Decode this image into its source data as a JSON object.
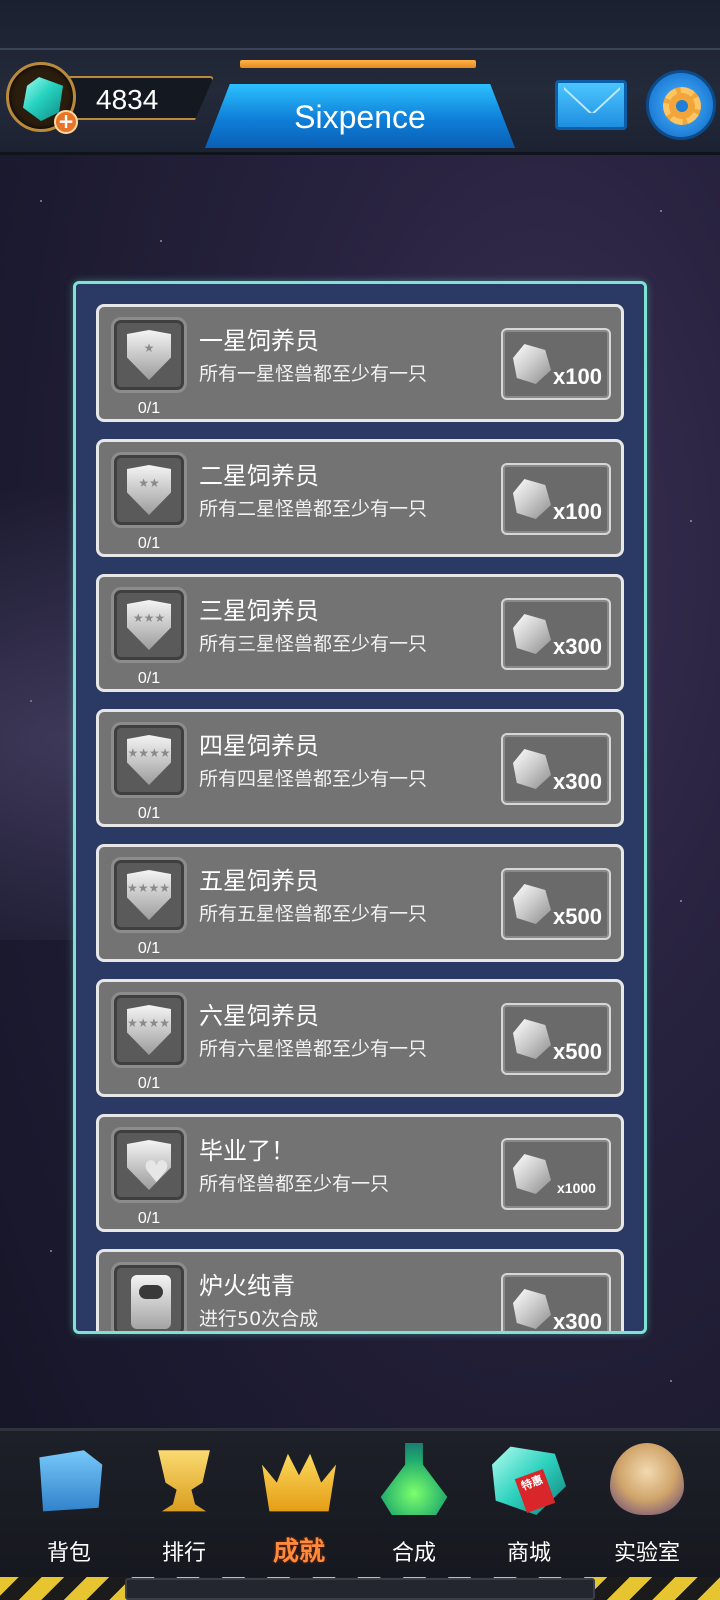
{
  "header": {
    "currency_amount": "4834",
    "player_name": "Sixpence"
  },
  "achievements": [
    {
      "title": "一星饲养员",
      "desc": "所有一星怪兽都至少有一只",
      "progress": "0/1",
      "reward": "x100",
      "badge": "shield-1-star-icon",
      "stars": "★"
    },
    {
      "title": "二星饲养员",
      "desc": "所有二星怪兽都至少有一只",
      "progress": "0/1",
      "reward": "x100",
      "badge": "shield-2-star-icon",
      "stars": "★★"
    },
    {
      "title": "三星饲养员",
      "desc": "所有三星怪兽都至少有一只",
      "progress": "0/1",
      "reward": "x300",
      "badge": "shield-3-star-icon",
      "stars": "★★★"
    },
    {
      "title": "四星饲养员",
      "desc": "所有四星怪兽都至少有一只",
      "progress": "0/1",
      "reward": "x300",
      "badge": "shield-4-star-icon",
      "stars": "★★★★"
    },
    {
      "title": "五星饲养员",
      "desc": "所有五星怪兽都至少有一只",
      "progress": "0/1",
      "reward": "x500",
      "badge": "shield-5-star-icon",
      "stars": "★★★★★"
    },
    {
      "title": "六星饲养员",
      "desc": "所有六星怪兽都至少有一只",
      "progress": "0/1",
      "reward": "x500",
      "badge": "shield-6-star-icon",
      "stars": "★★★★★★"
    },
    {
      "title": "毕业了！",
      "desc": "所有怪兽都至少有一只",
      "progress": "0/1",
      "reward": "x1000",
      "badge": "shield-heart-icon",
      "stars": ""
    },
    {
      "title": "炉火纯青",
      "desc": "进行50次合成",
      "progress": "",
      "reward": "x300",
      "badge": "robot-icon",
      "stars": ""
    }
  ],
  "nav": {
    "bag": "背包",
    "rank": "排行",
    "achievement": "成就",
    "synthesis": "合成",
    "shop": "商城",
    "lab": "实验室",
    "shop_tag": "特惠"
  },
  "active_tab": "achievement"
}
